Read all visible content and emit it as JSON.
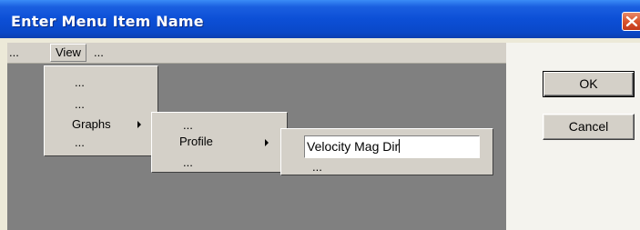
{
  "window": {
    "title": "Enter Menu Item Name"
  },
  "menubar": {
    "items": [
      "...",
      "View",
      "..."
    ]
  },
  "menu1": {
    "items": [
      "...",
      "...",
      "Graphs",
      "..."
    ]
  },
  "menu2": {
    "items": [
      "...",
      "Profile",
      "..."
    ]
  },
  "menu3": {
    "edit_value": "Velocity Mag Dir",
    "below": "..."
  },
  "buttons": {
    "ok": "OK",
    "cancel": "Cancel"
  },
  "icons": {
    "close": "close-icon",
    "submenu": "submenu-arrow-icon"
  },
  "colors": {
    "titlebar": "#0a48c8",
    "close": "#d9552e",
    "canvas": "#808080",
    "menu": "#d4d0c8"
  }
}
